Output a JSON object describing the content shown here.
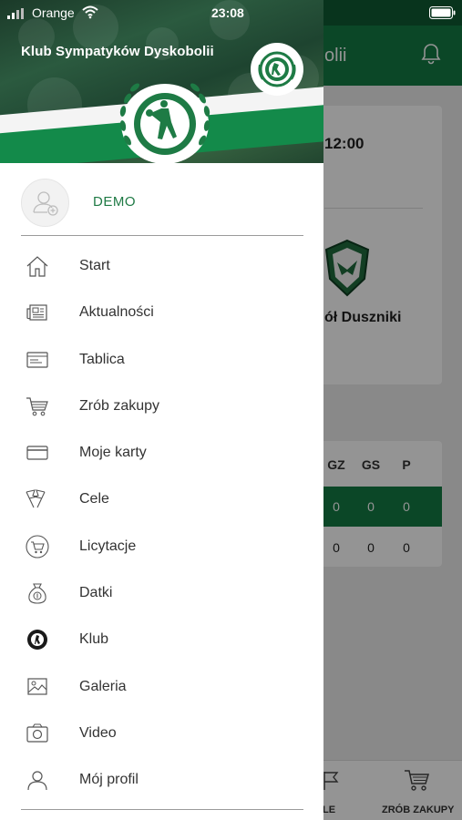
{
  "status_bar": {
    "carrier": "Orange",
    "time": "23:08"
  },
  "background": {
    "header_title_partial": "olii",
    "match_time_partial": "12:00",
    "team_partial": "ół Duszniki",
    "table_headers": [
      "GZ",
      "GS",
      "P"
    ],
    "table_rows": [
      [
        "0",
        "0",
        "0"
      ],
      [
        "0",
        "0",
        "0"
      ]
    ],
    "tabs": {
      "left_partial": "LE",
      "right": "ZRÓB ZAKUPY"
    },
    "accent_color": "#137a44"
  },
  "drawer": {
    "title": "Klub Sympatyków Dyskobolii",
    "user_name": "DEMO",
    "accent_color": "#1f7a45",
    "items": [
      {
        "label": "Start",
        "icon": "home-icon"
      },
      {
        "label": "Aktualności",
        "icon": "newspaper-icon"
      },
      {
        "label": "Tablica",
        "icon": "board-icon"
      },
      {
        "label": "Zrób zakupy",
        "icon": "cart-icon"
      },
      {
        "label": "Moje karty",
        "icon": "card-icon"
      },
      {
        "label": "Cele",
        "icon": "flags-icon"
      },
      {
        "label": "Licytacje",
        "icon": "auction-cart-icon"
      },
      {
        "label": "Datki",
        "icon": "money-bag-icon"
      },
      {
        "label": "Klub",
        "icon": "club-crest-icon"
      },
      {
        "label": "Galeria",
        "icon": "image-icon"
      },
      {
        "label": "Video",
        "icon": "camera-icon"
      },
      {
        "label": "Mój profil",
        "icon": "user-icon"
      }
    ]
  }
}
